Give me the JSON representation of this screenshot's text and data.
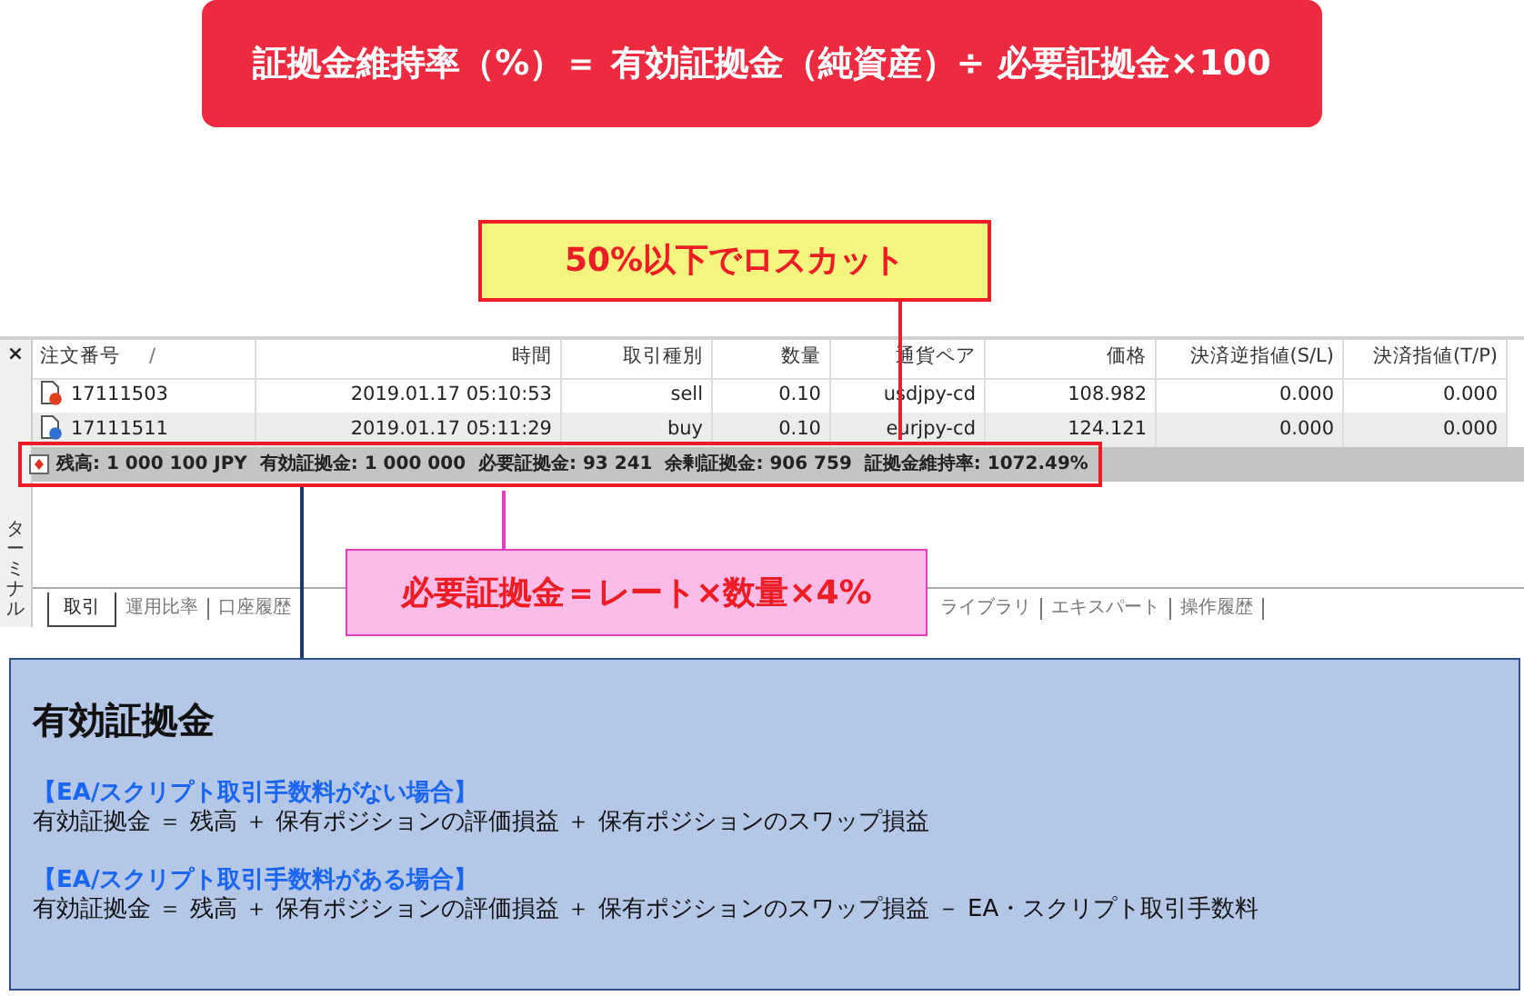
{
  "formula_banner": {
    "text": "証拠金維持率（%）＝ 有効証拠金（純資産）÷ 必要証拠金×100"
  },
  "callouts": [
    {
      "kind": "losscut",
      "text": "50%以下でロスカット"
    },
    {
      "kind": "required_margin",
      "text": "必要証拠金＝レート×数量×4%"
    }
  ],
  "terminal": {
    "close_mark": "×",
    "side_label": "ターミナル",
    "columns": [
      {
        "label": "注文番号",
        "sort_mark": "/"
      },
      {
        "label": "時間"
      },
      {
        "label": "取引種別"
      },
      {
        "label": "数量"
      },
      {
        "label": "通貨ペア"
      },
      {
        "label": "価格"
      },
      {
        "label": "決済逆指値(S/L)"
      },
      {
        "label": "決済指値(T/P)"
      }
    ],
    "rows": [
      {
        "color": "#e0401e",
        "cells": [
          "17111503",
          "2019.01.17 05:10:53",
          "sell",
          "0.10",
          "usdjpy-cd",
          "108.982",
          "0.000",
          "0.000"
        ]
      },
      {
        "color": "#2f6fd0",
        "cells": [
          "17111511",
          "2019.01.17 05:11:29",
          "buy",
          "0.10",
          "eurjpy-cd",
          "124.121",
          "0.000",
          "0.000"
        ]
      }
    ],
    "summary": "残高: 1 000 100 JPY  有効証拠金: 1 000 000  必要証拠金: 93 241  余剰証拠金: 906 759  証拠金維持率: 1072.49%",
    "tabs": [
      {
        "label": "取引",
        "selected": true
      },
      {
        "label": "運用比率",
        "selected": false
      },
      {
        "label": "口座履歴",
        "selected": false
      },
      {
        "label": "ライブラリ",
        "selected": false
      },
      {
        "label": "エキスパート",
        "selected": false
      },
      {
        "label": "操作履歴",
        "selected": false
      }
    ]
  },
  "explanation": {
    "title": "有効証拠金",
    "cases": [
      {
        "heading": "【EA/スクリプト取引手数料がない場合】",
        "formula": "有効証拠金 ＝ 残高 ＋ 保有ポジションの評価損益 ＋ 保有ポジションのスワップ損益"
      },
      {
        "heading": "【EA/スクリプト取引手数料がある場合】",
        "formula": "有効証拠金 ＝ 残高 ＋ 保有ポジションの評価損益 ＋ 保有ポジションのスワップ損益 － EA・スクリプト取引手数料"
      }
    ]
  }
}
